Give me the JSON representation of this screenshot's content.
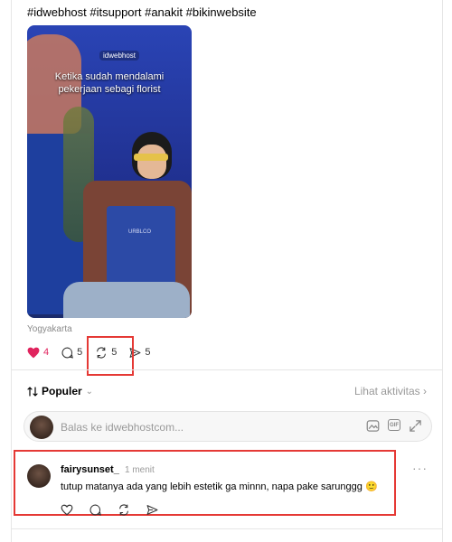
{
  "post": {
    "hashtags": "#idwebhost #itsupport #anakit #bikinwebsite",
    "video": {
      "caption": "Ketika sudah mendalami pekerjaan sebagi florist",
      "brand": "idwebhost",
      "apron_text": "URBLCO"
    },
    "location": "Yogyakarta",
    "likes": "4",
    "comments": "5",
    "reposts": "5",
    "shares": "5"
  },
  "thread": {
    "sort_label": "Populer",
    "activity_link": "Lihat aktivitas ›"
  },
  "reply": {
    "placeholder": "Balas ke idwebhostcom..."
  },
  "comment": {
    "username": "fairysunset_",
    "time": "1 menit",
    "text": "tutup matanya ada yang lebih estetik ga minnn, napa pake sarunggg 🙂"
  },
  "colors": {
    "like": "#e0245e",
    "highlight": "#e53935",
    "apron": "#2c4aa6"
  }
}
